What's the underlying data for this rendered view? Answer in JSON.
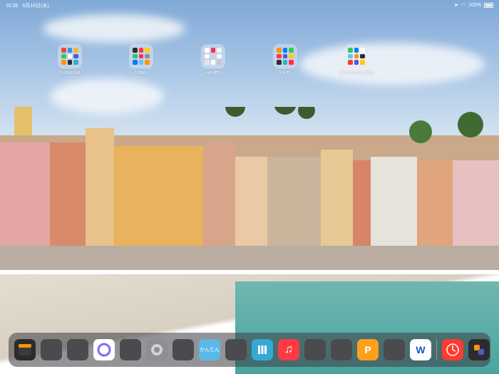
{
  "status_bar": {
    "time": "10:35",
    "date": "6月10日(水)",
    "battery": "100%"
  },
  "folders": [
    {
      "label": "Essential",
      "tiles": [
        "#e94b3c",
        "#3a8df0",
        "#f5b62b",
        "#34c759",
        "#ffffff",
        "#5856d6",
        "#ff9500",
        "#2c2c2e",
        "#30b0c7"
      ]
    },
    {
      "label": "Utility",
      "tiles": [
        "#2c2c2e",
        "#ff3b30",
        "#ffcc00",
        "#34c759",
        "#ff2d55",
        "#8e8e93",
        "#007aff",
        "#5ac8fa",
        "#ff9500"
      ]
    },
    {
      "label": "Health",
      "tiles": [
        "#ffffff",
        "#ff2d55",
        "#f2f2f7",
        "#ffffff",
        "#d1d1d6",
        "#ffffff",
        "#e5e5ea",
        "#ffffff",
        "#c7c7cc"
      ]
    },
    {
      "label": "Earth",
      "tiles": [
        "#ff9500",
        "#007aff",
        "#34c759",
        "#ff3b30",
        "#5856d6",
        "#ffcc00",
        "#2c2c2e",
        "#30b0c7",
        "#ff2d55"
      ]
    },
    {
      "label": "Communication",
      "tiles": [
        "#34c759",
        "#007aff",
        "#ffffff",
        "#5ac8fa",
        "#ff9500",
        "#2c2c2e",
        "#ff3b30",
        "#5856d6",
        "#ffcc00"
      ]
    }
  ],
  "dock": {
    "apps": [
      {
        "name": "widget-calendar-app",
        "bg": "#2b2b2e",
        "text": ""
      },
      {
        "name": "app-folder-1",
        "bg": "#4a4a4f",
        "grid": true
      },
      {
        "name": "app-folder-2",
        "bg": "#4a4a4f",
        "grid": true
      },
      {
        "name": "circle-app",
        "bg": "#ffffff",
        "text": ""
      },
      {
        "name": "app-folder-3",
        "bg": "#4a4a4f",
        "grid": true
      },
      {
        "name": "settings-app",
        "bg": "#8e8e93",
        "text": ""
      },
      {
        "name": "app-folder-4",
        "bg": "#4a4a4f",
        "grid": true
      },
      {
        "name": "kantan-app",
        "bg": "#5bb8e8",
        "text": "かんたん"
      },
      {
        "name": "app-folder-5",
        "bg": "#4a4a4f",
        "grid": true
      },
      {
        "name": "books-app",
        "bg": "#35a9d6",
        "text": ""
      },
      {
        "name": "music-app",
        "bg": "#fc3c44",
        "text": "♫"
      },
      {
        "name": "app-folder-6",
        "bg": "#4a4a4f",
        "grid": true
      },
      {
        "name": "app-folder-7",
        "bg": "#4a4a4f",
        "grid": true
      },
      {
        "name": "p-app",
        "bg": "#ff9f1c",
        "text": "P"
      },
      {
        "name": "app-folder-8",
        "bg": "#4a4a4f",
        "grid": true
      },
      {
        "name": "word-app",
        "bg": "#ffffff",
        "text": "W"
      },
      {
        "name": "clock-app",
        "bg": "#ff3b30",
        "text": ""
      },
      {
        "name": "shortcuts-app",
        "bg": "#2c2c2e",
        "text": ""
      }
    ]
  }
}
